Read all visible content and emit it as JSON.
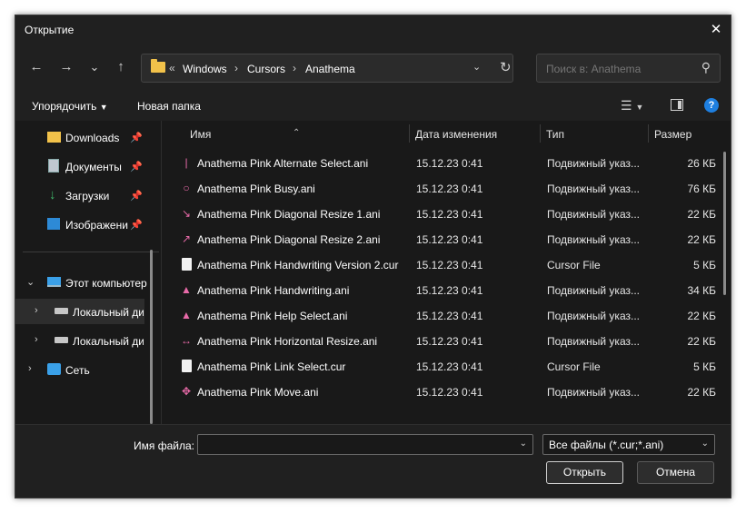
{
  "window": {
    "title": "Открытие"
  },
  "nav": {
    "back": "←",
    "forward": "→",
    "recent": "⌄",
    "up": "↑",
    "breadcrumb_prefix": "«",
    "breadcrumb": [
      "Windows",
      "Cursors",
      "Anathema"
    ],
    "search_placeholder": "Поиск в: Anathema"
  },
  "toolbar": {
    "organize": "Упорядочить",
    "new_folder": "Новая папка",
    "help": "?"
  },
  "sidebar": {
    "quick": [
      {
        "label": "Downloads",
        "icon": "folder-icon"
      },
      {
        "label": "Документы",
        "icon": "documents-icon"
      },
      {
        "label": "Загрузки",
        "icon": "download-icon"
      },
      {
        "label": "Изображени",
        "icon": "pictures-icon"
      }
    ],
    "tree": [
      {
        "label": "Этот компьютер",
        "icon": "computer-icon",
        "chevron": "⌄"
      },
      {
        "label": "Локальный ди",
        "icon": "drive-icon",
        "chevron": "›"
      },
      {
        "label": "Локальный ди",
        "icon": "drive-icon",
        "chevron": "›"
      },
      {
        "label": "Сеть",
        "icon": "network-icon",
        "chevron": "›"
      }
    ]
  },
  "columns": {
    "name": "Имя",
    "date": "Дата изменения",
    "type": "Тип",
    "size": "Размер"
  },
  "files": [
    {
      "name": "Anathema Pink Alternate Select.ani",
      "date": "15.12.23 0:41",
      "type": "Подвижный указ...",
      "size": "26 КБ",
      "icon": "|"
    },
    {
      "name": "Anathema Pink Busy.ani",
      "date": "15.12.23 0:41",
      "type": "Подвижный указ...",
      "size": "76 КБ",
      "icon": "○"
    },
    {
      "name": "Anathema Pink Diagonal Resize 1.ani",
      "date": "15.12.23 0:41",
      "type": "Подвижный указ...",
      "size": "22 КБ",
      "icon": "↘"
    },
    {
      "name": "Anathema Pink Diagonal Resize 2.ani",
      "date": "15.12.23 0:41",
      "type": "Подвижный указ...",
      "size": "22 КБ",
      "icon": "↗"
    },
    {
      "name": "Anathema Pink Handwriting Version 2.cur",
      "date": "15.12.23 0:41",
      "type": "Cursor File",
      "size": "5 КБ",
      "icon": ""
    },
    {
      "name": "Anathema Pink Handwriting.ani",
      "date": "15.12.23 0:41",
      "type": "Подвижный указ...",
      "size": "34 КБ",
      "icon": "▲"
    },
    {
      "name": "Anathema Pink Help Select.ani",
      "date": "15.12.23 0:41",
      "type": "Подвижный указ...",
      "size": "22 КБ",
      "icon": "▲"
    },
    {
      "name": "Anathema Pink Horizontal Resize.ani",
      "date": "15.12.23 0:41",
      "type": "Подвижный указ...",
      "size": "22 КБ",
      "icon": "↔"
    },
    {
      "name": "Anathema Pink Link Select.cur",
      "date": "15.12.23 0:41",
      "type": "Cursor File",
      "size": "5 КБ",
      "icon": ""
    },
    {
      "name": "Anathema Pink Move.ani",
      "date": "15.12.23 0:41",
      "type": "Подвижный указ...",
      "size": "22 КБ",
      "icon": "✥"
    }
  ],
  "bottom": {
    "filename_label": "Имя файла:",
    "filename_value": "",
    "filter": "Все файлы (*.cur;*.ani)",
    "open": "Открыть",
    "cancel": "Отмена"
  }
}
